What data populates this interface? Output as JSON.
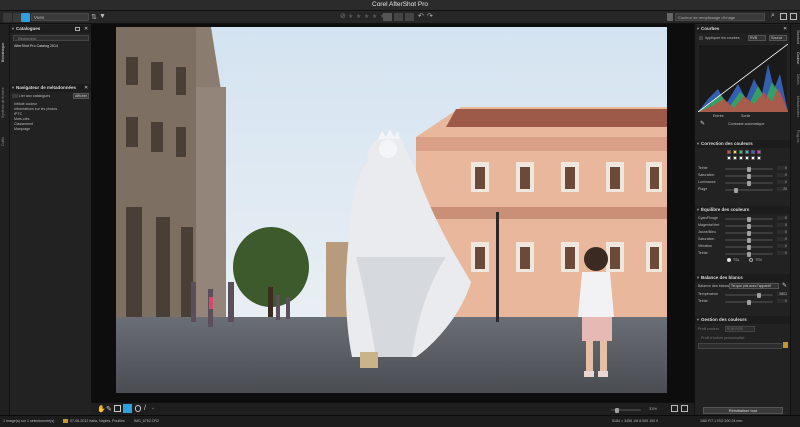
{
  "app": {
    "title": "Corel AfterShot Pro"
  },
  "toolbar": {
    "view_select": "Vues",
    "color_preset": "Couleur de remplissage d'image"
  },
  "left_tabs": [
    "Bibliothèque",
    "Système de fichiers",
    "Outils"
  ],
  "catalogues": {
    "header": "Catalogues",
    "search": "Rechercher",
    "item": "AfterShot Pro Catalog 2014"
  },
  "metadata": {
    "header": "Navigateur de métadonnées",
    "show_button": "Afficher",
    "search_label": "Lier aux catalogues",
    "items": [
      "Intitulé couleur",
      "Informations sur les photos",
      "IPTC",
      "Mots-clés",
      "Classement",
      "Marquage"
    ]
  },
  "right_tabs": [
    "Standard",
    "Couleur",
    "Détails",
    "Métadonnées",
    "Plug-ins"
  ],
  "curves": {
    "header": "Courbes",
    "apply_label": "Appliquer les courbes",
    "channel": "RVB",
    "mode": "Source",
    "labels": [
      "Entrée",
      "Sortie",
      "Contraste automatique"
    ],
    "values": [
      "0",
      "0",
      "0"
    ]
  },
  "color_correction": {
    "header": "Correction des couleurs",
    "swatches_top": [
      "#ff3a3a",
      "#ffe033",
      "#34d934",
      "#2fc4e6",
      "#3c5dff",
      "#e43ae4"
    ],
    "swatches_bottom": [
      "#ffffff",
      "#ffffff",
      "#ffffff",
      "#ffffff",
      "#ffffff",
      "#ffffff"
    ],
    "sliders": [
      {
        "label": "Teinte",
        "value": "0",
        "pos": 0.5
      },
      {
        "label": "Saturation",
        "value": "0",
        "pos": 0.5
      },
      {
        "label": "Luminance",
        "value": "0",
        "pos": 0.5
      },
      {
        "label": "Plage",
        "value": "20",
        "pos": 0.2
      }
    ]
  },
  "color_balance": {
    "header": "Équilibre des couleurs",
    "sliders": [
      {
        "label": "Cyan/Rouge",
        "value": "0",
        "pos": 0.5
      },
      {
        "label": "Magenta/Vert",
        "value": "0",
        "pos": 0.5
      },
      {
        "label": "Jaune/Bleu",
        "value": "0",
        "pos": 0.5
      },
      {
        "label": "Saturation",
        "value": "0",
        "pos": 0.5
      },
      {
        "label": "Vibration",
        "value": "0",
        "pos": 0.5
      },
      {
        "label": "Teinte",
        "value": "0",
        "pos": 0.5
      }
    ],
    "options": [
      "TSL",
      "TSV"
    ]
  },
  "white_balance": {
    "header": "Balance des blancs",
    "wb_label": "Balance des blancs",
    "wb_value": "Tel que pris avec l'appareil",
    "sliders": [
      {
        "label": "Température",
        "value": "5801",
        "pos": 0.72
      },
      {
        "label": "Teinte",
        "value": "0",
        "pos": 0.5
      }
    ]
  },
  "color_management": {
    "header": "Gestion des couleurs",
    "space_label": "Profil couleur",
    "space_value": "RGB RGB",
    "profile_label": "Profil d'entrée personnalisé"
  },
  "reset_button": "Réinitialiser tout",
  "bottom": {
    "zoom": "33%"
  },
  "status": {
    "selection": "1 image(s) sur 1 sélectionnée(s)",
    "folder": "07-06-2012 Italia, Naples, Pouilles",
    "file": "IMG_6752.CR2",
    "info": "5184 × 3456   1/8   8.000   100   0",
    "exif": "1/60  F/7.1  ISO 200  24 mm"
  }
}
